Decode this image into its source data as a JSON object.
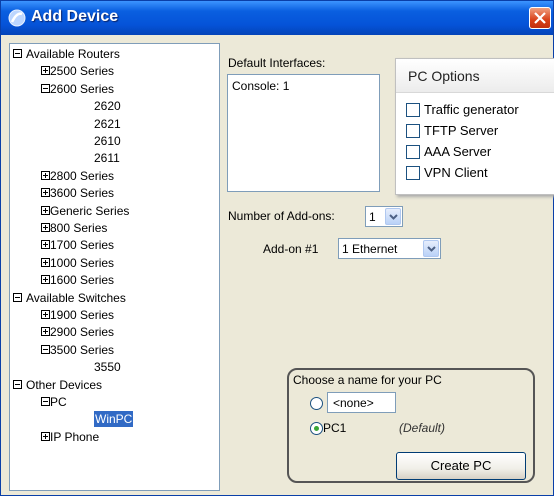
{
  "window": {
    "title": "Add Device"
  },
  "tree": {
    "rows": [
      {
        "label": "Available Routers",
        "level": 0,
        "expander": "minus"
      },
      {
        "label": "2500 Series",
        "level": 1,
        "expander": "plus"
      },
      {
        "label": "2600 Series",
        "level": 1,
        "expander": "minus"
      },
      {
        "label": "2620",
        "level": 2,
        "expander": "none"
      },
      {
        "label": "2621",
        "level": 2,
        "expander": "none"
      },
      {
        "label": "2610",
        "level": 2,
        "expander": "none"
      },
      {
        "label": "2611",
        "level": 2,
        "expander": "none"
      },
      {
        "label": "2800 Series",
        "level": 1,
        "expander": "plus"
      },
      {
        "label": "3600 Series",
        "level": 1,
        "expander": "plus"
      },
      {
        "label": "Generic Series",
        "level": 1,
        "expander": "plus"
      },
      {
        "label": "800 Series",
        "level": 1,
        "expander": "plus"
      },
      {
        "label": "1700 Series",
        "level": 1,
        "expander": "plus"
      },
      {
        "label": "1000 Series",
        "level": 1,
        "expander": "plus"
      },
      {
        "label": "1600 Series",
        "level": 1,
        "expander": "plus"
      },
      {
        "label": "Available Switches",
        "level": 0,
        "expander": "minus"
      },
      {
        "label": "1900 Series",
        "level": 1,
        "expander": "plus"
      },
      {
        "label": "2900 Series",
        "level": 1,
        "expander": "plus"
      },
      {
        "label": "3500 Series",
        "level": 1,
        "expander": "minus"
      },
      {
        "label": "3550",
        "level": 2,
        "expander": "none"
      },
      {
        "label": "Other Devices",
        "level": 0,
        "expander": "minus"
      },
      {
        "label": "PC",
        "level": 1,
        "expander": "minus"
      },
      {
        "label": "WinPC",
        "level": 2,
        "expander": "none",
        "selected": true
      },
      {
        "label": "IP Phone",
        "level": 1,
        "expander": "plus"
      }
    ]
  },
  "interfaces": {
    "label": "Default Interfaces:",
    "value": "Console: 1"
  },
  "pc_options": {
    "title": "PC Options",
    "items": [
      {
        "label": "Traffic generator",
        "checked": false
      },
      {
        "label": "TFTP Server",
        "checked": false
      },
      {
        "label": "AAA Server",
        "checked": false
      },
      {
        "label": "VPN Client",
        "checked": false
      }
    ]
  },
  "addons": {
    "count_label": "Number of Add-ons:",
    "count_value": "1",
    "addon1_label": "Add-on #1",
    "addon1_value": "1 Ethernet"
  },
  "name_group": {
    "title": "Choose a name for your PC",
    "custom_value": "<none>",
    "default_option": "PC1",
    "default_note": "(Default)",
    "selected": "default"
  },
  "create_button": {
    "label": "Create PC"
  },
  "colors": {
    "title_bar": "#0553d8",
    "selection": "#316ac5",
    "radio_check": "#3aa635"
  }
}
